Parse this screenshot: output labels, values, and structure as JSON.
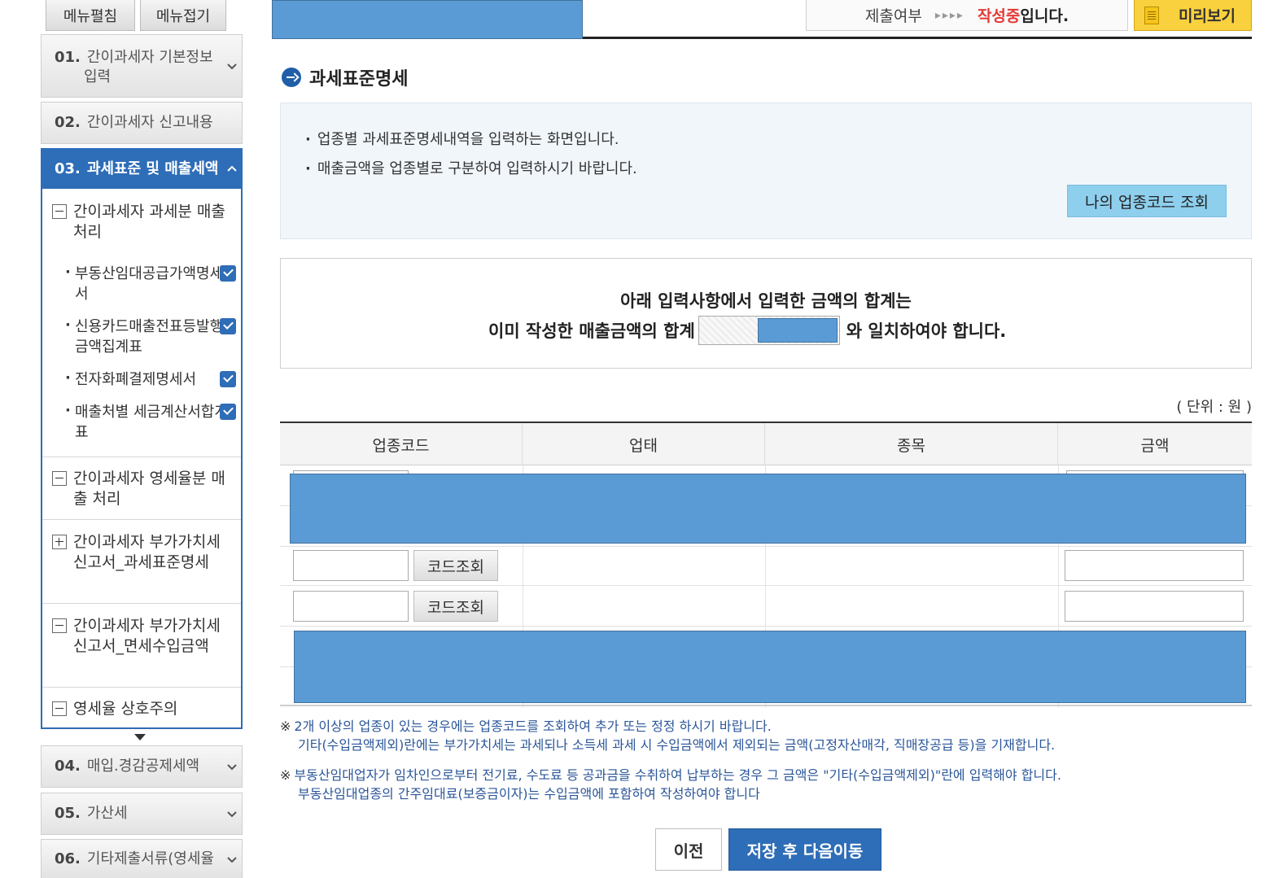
{
  "sidebar": {
    "menu_expand": "메뉴펼침",
    "menu_collapse": "메뉴접기",
    "steps": [
      {
        "num": "01.",
        "label": "간이과세자 기본정보",
        "label2": "입력"
      },
      {
        "num": "02.",
        "label": "간이과세자 신고내용"
      },
      {
        "num": "03.",
        "label": "과세표준 및 매출세액"
      },
      {
        "num": "04.",
        "label": "매입.경감공제세액"
      },
      {
        "num": "05.",
        "label": "가산세"
      },
      {
        "num": "06.",
        "label": "기타제출서류(영세율"
      }
    ],
    "sub": {
      "sec1_title": "간이과세자 과세분 매출 처리",
      "items": [
        "부동산임대공급가액명세서",
        "신용카드매출전표등발행금액집계표",
        "전자화폐결제명세서",
        "매출처별 세금계산서합계표"
      ],
      "sec2_title": "간이과세자 영세율분 매출 처리",
      "sec3_title": "간이과세자 부가가치세 신고서_과세표준명세",
      "sec4_title": "간이과세자 부가가치세 신고서_면세수입금액",
      "sec5_title": "영세율 상호주의"
    }
  },
  "topbar": {
    "status_label": "제출여부",
    "status_arrows": "▸▸▸▸",
    "status_value": "작성중",
    "status_suffix": "입니다.",
    "preview": "미리보기"
  },
  "main": {
    "title": "과세표준명세",
    "info": [
      "업종별 과세표준명세내역을 입력하는 화면입니다.",
      "매출금액을 업종별로 구분하여 입력하시기 바랍니다."
    ],
    "my_code_button": "나의 업종코드 조회",
    "notice_line1": "아래 입력사항에서  입력한 금액의 합계는",
    "notice_line2_pre": "이미 작성한 매출금액의 합계",
    "notice_line2_post": "와 일치하여야 합니다.",
    "unit": "( 단위 : 원 )",
    "table": {
      "headers": [
        "업종코드",
        "업태",
        "종목",
        "금액"
      ],
      "lookup_button": "코드조회"
    },
    "notes": [
      {
        "mark": "※",
        "line1": "2개 이상의 업종이 있는 경우에는 업종코드를 조회하여 추가 또는 정정 하시기 바랍니다.",
        "line2": "기타(수입금액제외)란에는 부가가치세는 과세되나 소득세 과세 시 수입금액에서 제외되는 금액(고정자산매각, 직매장공급 등)을 기재합니다."
      },
      {
        "mark": "※",
        "line1": "부동산임대업자가 임차인으로부터 전기료, 수도료 등 공과금을 수취하여 납부하는 경우 그 금액은 \"기타(수입금액제외)\"란에 입력해야 합니다.",
        "line2": "부동산임대업종의 간주임대료(보증금이자)는 수입금액에 포함하여 작성하여야 합니다"
      }
    ],
    "prev_button": "이전",
    "next_button": "저장 후 다음이동"
  },
  "colors": {
    "accent": "#2e6db7",
    "mask": "#5b9bd5",
    "status_red": "#e53935",
    "preview_yellow": "#f9d13e"
  }
}
